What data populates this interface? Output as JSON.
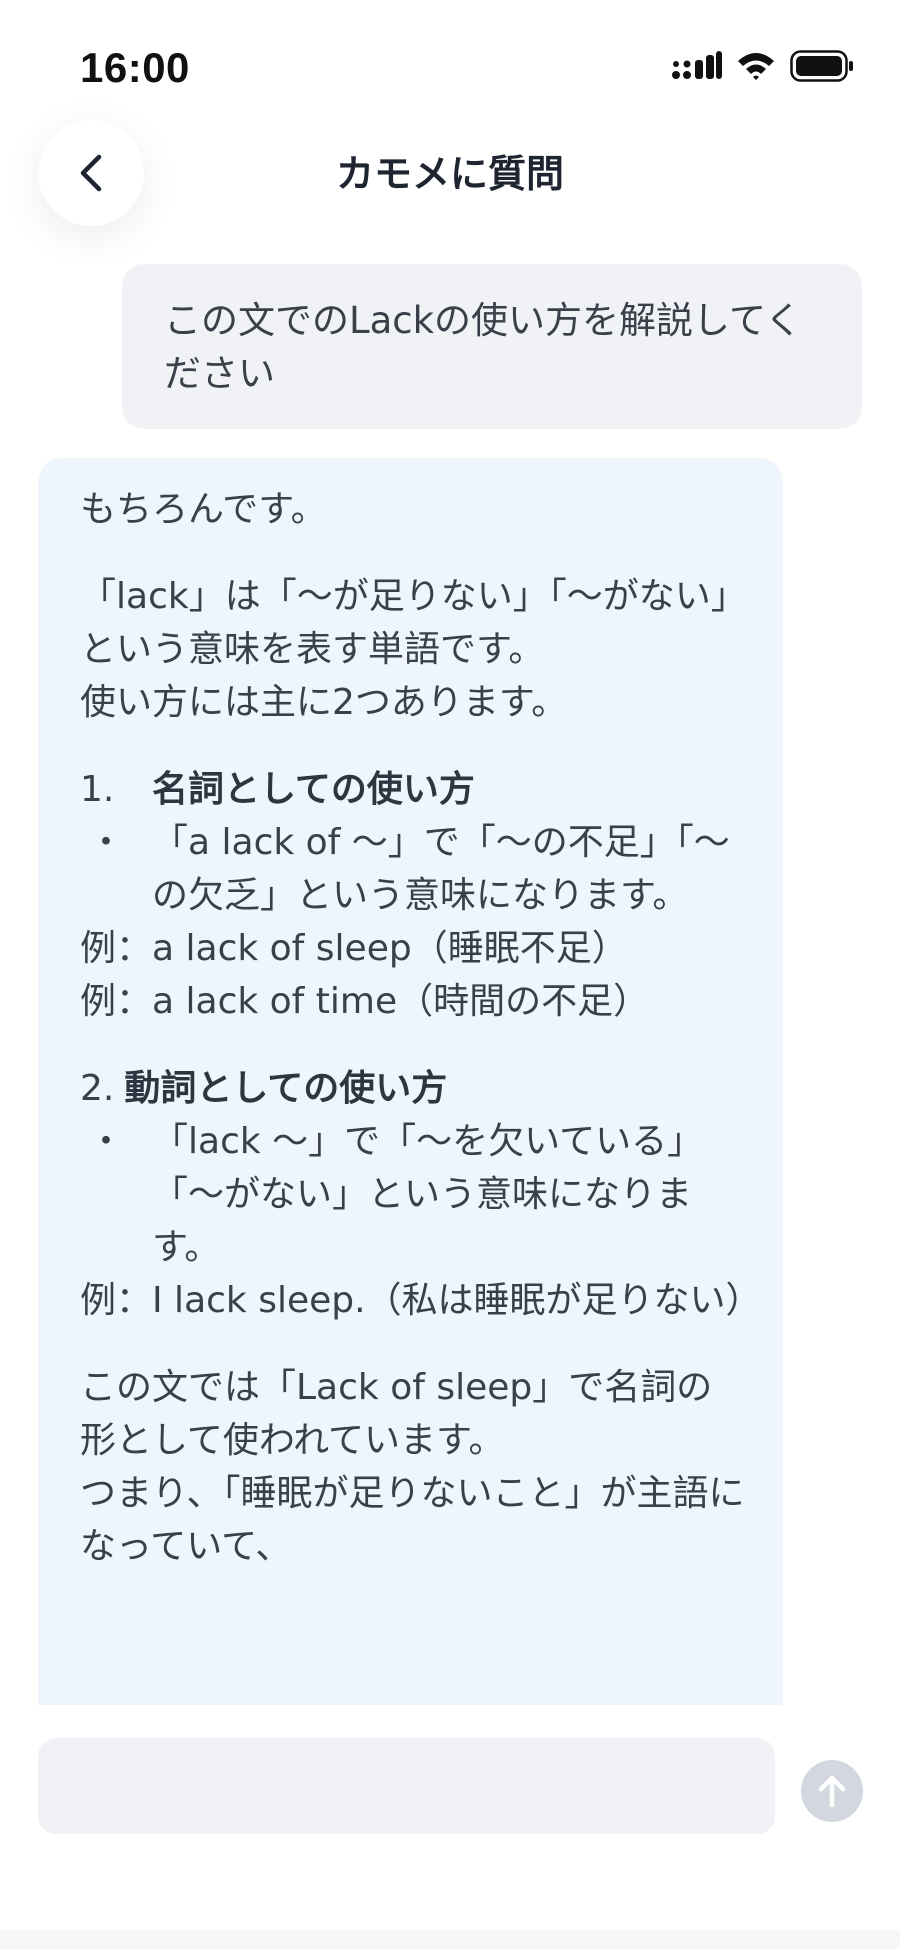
{
  "status_bar": {
    "time": "16:00"
  },
  "header": {
    "title": "カモメに質問"
  },
  "user_message": "この文でのLackの使い方を解説してください",
  "ai_message": {
    "greeting": "もちろんです。",
    "intro_line1": "「lack」は「～が足りない」「～がない」という意味を表す単語です。",
    "intro_line2": "使い方には主に2つあります。",
    "section1": {
      "number": "1.",
      "heading": "名詞としての使い方",
      "bullet": "・",
      "bullet_text": "「a lack of ～」で「～の不足」「～の欠乏」という意味になります。",
      "example1": "例：a lack of sleep（睡眠不足）",
      "example2": "例：a lack of time（時間の不足）"
    },
    "section2": {
      "number": "2.",
      "heading": "動詞としての使い方",
      "bullet": "・",
      "bullet_text": "「lack ～」で「～を欠いている」「～がない」という意味になります。",
      "example1": "例：I lack sleep.（私は睡眠が足りない）"
    },
    "conclusion_line1": "この文では「Lack of sleep」で名詞の形として使われています。",
    "conclusion_line2": "つまり、「睡眠が足りないこと」が主語になっていて、"
  },
  "composer": {
    "placeholder": ""
  }
}
